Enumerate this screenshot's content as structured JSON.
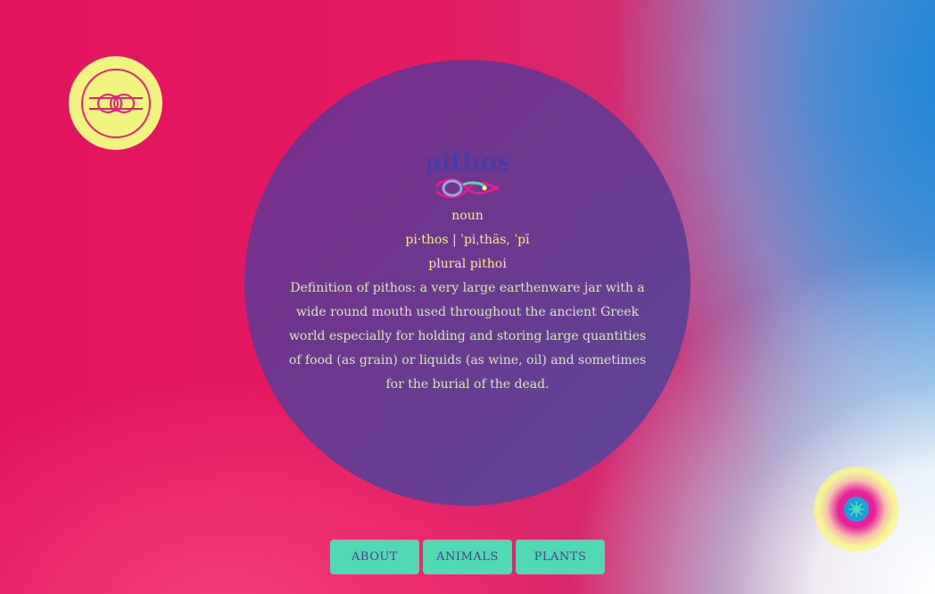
{
  "logo": {
    "icon": "knot-icon",
    "color": "#f2f480"
  },
  "entry": {
    "word": "pithos",
    "part_of_speech": "noun",
    "pronunciation": "pi·thos | ˈpiˌthäs, ˈpī",
    "plural": "plural pithoi",
    "definition": "Definition of pithos: a very large earthenware jar with a wide round mouth used throughout the ancient Greek world especially for holding and storing large quantities of food (as grain) or liquids (as wine, oil) and sometimes for the burial of the dead."
  },
  "nav": {
    "about": "ABOUT",
    "animals": "ANIMALS",
    "plants": "PLANTS"
  },
  "badge": {
    "icon": "flower-icon"
  },
  "colors": {
    "accent": "#4fd9b4",
    "circle": "#6c3a8e",
    "text": "#f0f08c",
    "background": "#e31460"
  }
}
